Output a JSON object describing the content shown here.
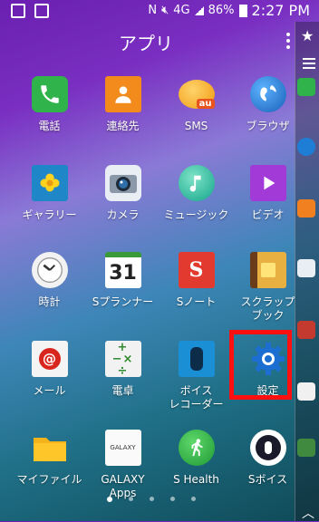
{
  "status": {
    "network": "4G",
    "battery": "86%",
    "time": "2:27 PM"
  },
  "header": {
    "title": "アプリ"
  },
  "apps": [
    {
      "label": "電話"
    },
    {
      "label": "連絡先"
    },
    {
      "label": "SMS"
    },
    {
      "label": "ブラウザ"
    },
    {
      "label": "ギャラリー"
    },
    {
      "label": "カメラ"
    },
    {
      "label": "ミュージック"
    },
    {
      "label": "ビデオ"
    },
    {
      "label": "時計"
    },
    {
      "label": "Sプランナー"
    },
    {
      "label": "Sノート"
    },
    {
      "label": "スクラップ\nブック"
    },
    {
      "label": "メール"
    },
    {
      "label": "電卓"
    },
    {
      "label": "ボイス\nレコーダー"
    },
    {
      "label": "設定"
    },
    {
      "label": "マイファイル"
    },
    {
      "label": "GALAXY\nApps"
    },
    {
      "label": "S Health"
    },
    {
      "label": "Sボイス"
    }
  ],
  "icon_text": {
    "sms_badge": "au",
    "calendar_day": "31",
    "snote_letter": "S",
    "email_symbol": "@",
    "calc": "+−×÷",
    "galaxy": "GALAXY"
  },
  "pager": {
    "count": 5,
    "current": 1
  }
}
